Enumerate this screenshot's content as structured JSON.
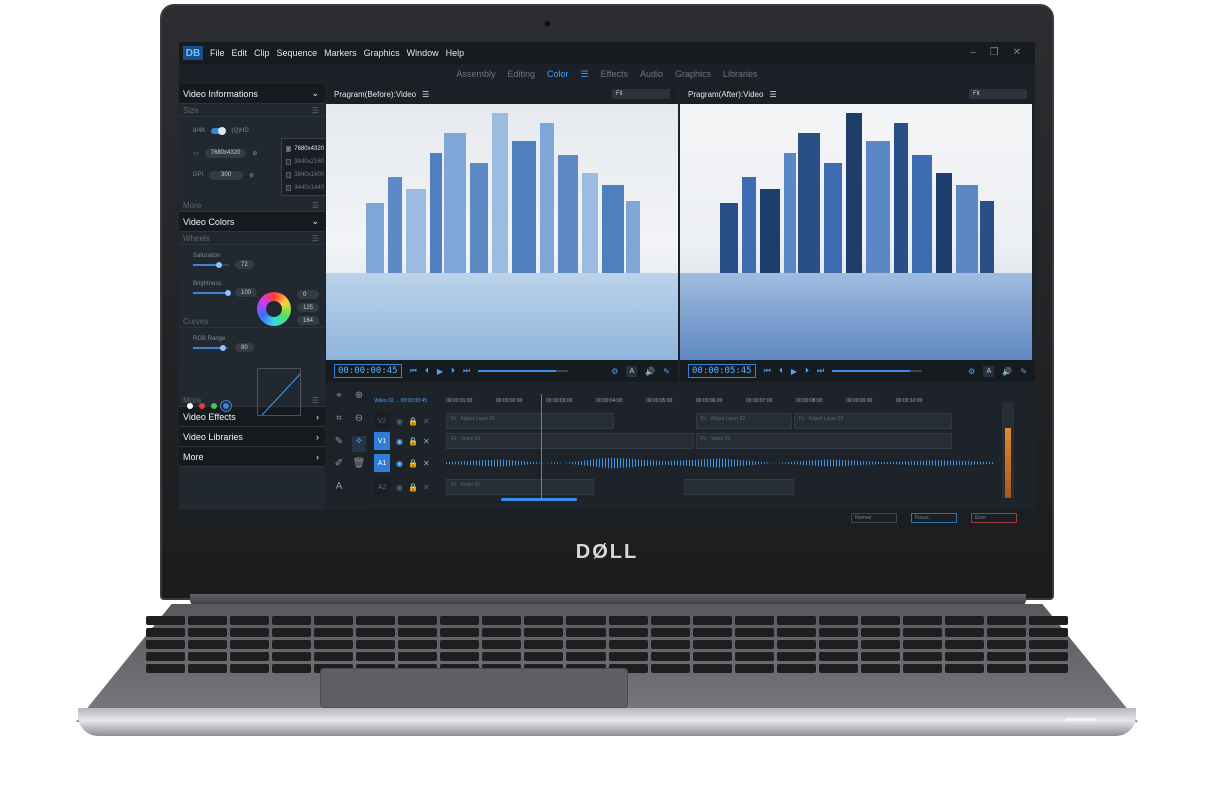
{
  "brand": {
    "logo_text": "DØLL"
  },
  "app": {
    "logo": "DB"
  },
  "menu": [
    "File",
    "Edit",
    "Clip",
    "Sequence",
    "Markers",
    "Graphics",
    "Window",
    "Help"
  ],
  "window_controls": {
    "minimize": "–",
    "restore": "❐",
    "close": "✕"
  },
  "workspaces": [
    "Assembly",
    "Editing",
    "Color",
    "Effects",
    "Audio",
    "Graphics",
    "Libraries"
  ],
  "active_workspace": "Color",
  "left_panel": {
    "video_info": "Video Informations",
    "size": "Size",
    "res_toggle_left": "8/4K",
    "res_toggle_right": "(Q)HD",
    "resolution_value": "7680x4320",
    "dpi_label": "DPI",
    "dpi_value": "300",
    "resolutions": [
      "7680x4320",
      "3840x2160",
      "3840x1600",
      "3440x1440"
    ],
    "more1": "More",
    "video_colors": "Video Colors",
    "wheels": "Wheels",
    "saturation_label": "Saturation",
    "saturation_value": "72",
    "brightness_label": "Brightness",
    "brightness_value": "100",
    "wheel_values": [
      "0",
      "125",
      "164"
    ],
    "curves": "Curves",
    "rgb_range_label": "RGB Range",
    "rgb_range_value": "80",
    "more2": "More",
    "video_effects": "Video Effects",
    "video_libraries": "Video Libraries",
    "more3": "More"
  },
  "viewers": {
    "before_title": "Pragram(Before):Video",
    "after_title": "Pragram(After):Video",
    "fit": "Fit",
    "timecode": "00:00:00:45",
    "timecode_after": "00:00:05:45"
  },
  "timeline": {
    "sequence_label": "Video 02 ... 00:00:00:45",
    "ruler": [
      "00:00:01:00",
      "00:00:02:00",
      "00:00:03:00",
      "00:00:04:00",
      "00:00:05:00",
      "00:00:06:00",
      "00:00:07:00",
      "00:00:08:00",
      "00:00:09:00",
      "00:00:10:00",
      "00:00:11:00"
    ],
    "tracks": [
      "V2",
      "V1",
      "A1",
      "A2"
    ],
    "clips": {
      "v2a": "Adjust Layer 01",
      "v2b": "Adjust Layer 02",
      "v2c": "Adjust Layer 03",
      "v1a": "Video 01",
      "v1b": "Video 03",
      "a2a": "Audio 01"
    },
    "fx": "Fx"
  },
  "status": [
    "Normal",
    "Focus",
    "Error"
  ]
}
